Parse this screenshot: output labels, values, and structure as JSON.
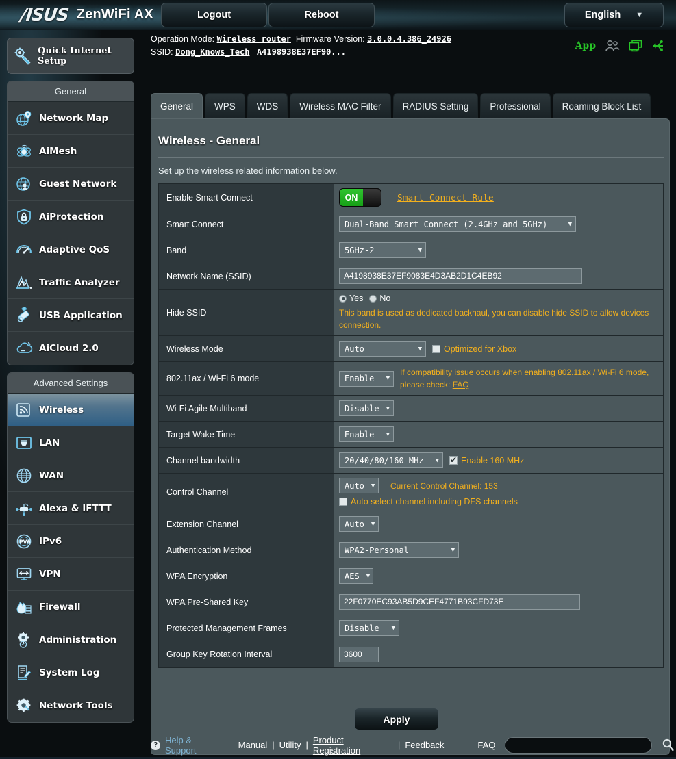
{
  "header": {
    "brand": "/ISUS",
    "model": "ZenWiFi AX",
    "logout_label": "Logout",
    "reboot_label": "Reboot",
    "language": "English",
    "caret": "▼"
  },
  "info": {
    "operation_mode_label": "Operation Mode:",
    "operation_mode_value": "Wireless router",
    "firmware_label": "Firmware Version:",
    "firmware_value": "3.0.0.4.386_24926",
    "ssid_label": "SSID:",
    "ssid_value": "Dong_Knows_Tech",
    "ssid_secondary": "A4198938E37EF90...",
    "app_label": "App"
  },
  "sidebar": {
    "quick_setup": "Quick Internet Setup",
    "general_header": "General",
    "general_items": [
      {
        "label": "Network Map",
        "icon": "network-map-icon"
      },
      {
        "label": "AiMesh",
        "icon": "aimesh-icon"
      },
      {
        "label": "Guest Network",
        "icon": "guest-network-icon"
      },
      {
        "label": "AiProtection",
        "icon": "shield-lock-icon"
      },
      {
        "label": "Adaptive QoS",
        "icon": "speedometer-icon"
      },
      {
        "label": "Traffic Analyzer",
        "icon": "traffic-chart-icon"
      },
      {
        "label": "USB Application",
        "icon": "usb-drive-icon"
      },
      {
        "label": "AiCloud 2.0",
        "icon": "cloud-icon"
      }
    ],
    "advanced_header": "Advanced Settings",
    "advanced_items": [
      {
        "label": "Wireless",
        "icon": "wireless-signal-icon",
        "active": true
      },
      {
        "label": "LAN",
        "icon": "lan-port-icon"
      },
      {
        "label": "WAN",
        "icon": "globe-icon"
      },
      {
        "label": "Alexa & IFTTT",
        "icon": "alexa-ifttt-icon"
      },
      {
        "label": "IPv6",
        "icon": "ipv6-icon"
      },
      {
        "label": "VPN",
        "icon": "vpn-icon"
      },
      {
        "label": "Firewall",
        "icon": "firewall-flame-icon"
      },
      {
        "label": "Administration",
        "icon": "admin-gear-icon"
      },
      {
        "label": "System Log",
        "icon": "system-log-icon"
      },
      {
        "label": "Network Tools",
        "icon": "network-tools-icon"
      }
    ]
  },
  "tabs": [
    {
      "label": "General",
      "active": true
    },
    {
      "label": "WPS",
      "active": false
    },
    {
      "label": "WDS",
      "active": false
    },
    {
      "label": "Wireless MAC Filter",
      "active": false
    },
    {
      "label": "RADIUS Setting",
      "active": false
    },
    {
      "label": "Professional",
      "active": false
    },
    {
      "label": "Roaming Block List",
      "active": false
    }
  ],
  "panel": {
    "title": "Wireless - General",
    "subtitle": "Set up the wireless related information below."
  },
  "settings": {
    "enable_smart_connect": {
      "label": "Enable Smart Connect",
      "toggle_state": "ON",
      "rule_link": "Smart Connect Rule"
    },
    "smart_connect": {
      "label": "Smart Connect",
      "value": "Dual-Band Smart Connect (2.4GHz and 5GHz)"
    },
    "band": {
      "label": "Band",
      "value": "5GHz-2"
    },
    "ssid": {
      "label": "Network Name (SSID)",
      "value": "A4198938E37EF9083E4D3AB2D1C4EB92"
    },
    "hide_ssid": {
      "label": "Hide SSID",
      "yes_label": "Yes",
      "no_label": "No",
      "selected": "Yes",
      "note": "This band is used as dedicated backhaul, you can disable hide SSID to allow devices connection."
    },
    "wireless_mode": {
      "label": "Wireless Mode",
      "value": "Auto",
      "xbox_label": "Optimized for Xbox",
      "xbox_checked": false
    },
    "ax_mode": {
      "label": "802.11ax / Wi-Fi 6 mode",
      "value": "Enable",
      "note": "If compatibility issue occurs when enabling 802.11ax / Wi-Fi 6 mode, please check:",
      "note_link": "FAQ"
    },
    "agile_multiband": {
      "label": "Wi-Fi Agile Multiband",
      "value": "Disable"
    },
    "target_wake_time": {
      "label": "Target Wake Time",
      "value": "Enable"
    },
    "channel_bandwidth": {
      "label": "Channel bandwidth",
      "value": "20/40/80/160 MHz",
      "enable160_label": "Enable 160 MHz",
      "enable160_checked": true
    },
    "control_channel": {
      "label": "Control Channel",
      "value": "Auto",
      "current_note": "Current Control Channel: 153",
      "dfs_label": "Auto select channel including DFS channels",
      "dfs_checked": false
    },
    "extension_channel": {
      "label": "Extension Channel",
      "value": "Auto"
    },
    "auth_method": {
      "label": "Authentication Method",
      "value": "WPA2-Personal"
    },
    "wpa_encryption": {
      "label": "WPA Encryption",
      "value": "AES"
    },
    "wpa_key": {
      "label": "WPA Pre-Shared Key",
      "value": "22F0770EC93AB5D9CEF4771B93CFD73E"
    },
    "pmf": {
      "label": "Protected Management Frames",
      "value": "Disable"
    },
    "group_key": {
      "label": "Group Key Rotation Interval",
      "value": "3600"
    },
    "apply_label": "Apply"
  },
  "footer": {
    "help_mark": "?",
    "help_label": "Help & Support",
    "manual": "Manual",
    "utility": "Utility",
    "product_registration": "Product Registration",
    "feedback": "Feedback",
    "separator": "|",
    "faq_label": "FAQ",
    "faq_placeholder": ""
  },
  "colors": {
    "accent_orange": "#f2b01e",
    "toggle_green": "#2fc32f",
    "active_menu_blue": "#2f5f85",
    "panel_bg": "#4b585c",
    "label_bg": "#2e383c"
  }
}
